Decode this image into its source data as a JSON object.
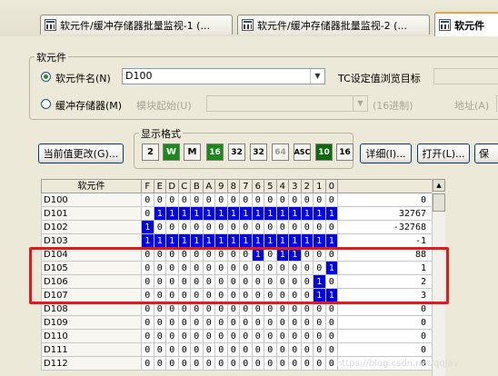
{
  "tabs": [
    {
      "label": "软元件/缓冲存储器批量监视-1 (..."
    },
    {
      "label": "软元件/缓冲存储器批量监视-2 (..."
    },
    {
      "label": "软元件"
    }
  ],
  "device_group": {
    "legend": "软元件",
    "device_name_label": "软元件名(N)",
    "device_name_value": "D100",
    "tc_label": "TC设定值浏览目标",
    "buffer_label": "缓冲存储器(M)",
    "module_start_label": "模块起始(U)",
    "hex_label": "(16进制)",
    "address_label": "地址(A)"
  },
  "format_group": {
    "legend": "显示格式",
    "buttons": [
      {
        "label": "2"
      },
      {
        "label": "W"
      },
      {
        "label": "M"
      },
      {
        "label": "16"
      },
      {
        "label": "32"
      },
      {
        "label": "32"
      },
      {
        "label": "64"
      },
      {
        "label": "ASC"
      },
      {
        "label": "10"
      },
      {
        "label": "16"
      }
    ]
  },
  "actions": {
    "change_value": "当前值更改(G)...",
    "details": "详细(I)...",
    "open": "打开(L)...",
    "save": "保"
  },
  "grid": {
    "header_device": "软元件",
    "bit_headers": [
      "F",
      "E",
      "D",
      "C",
      "B",
      "A",
      "9",
      "8",
      "7",
      "6",
      "5",
      "4",
      "3",
      "2",
      "1",
      "0"
    ],
    "rows": [
      {
        "name": "D100",
        "bits": [
          0,
          0,
          0,
          0,
          0,
          0,
          0,
          0,
          0,
          0,
          0,
          0,
          0,
          0,
          0,
          0
        ],
        "value": "0"
      },
      {
        "name": "D101",
        "bits": [
          0,
          1,
          1,
          1,
          1,
          1,
          1,
          1,
          1,
          1,
          1,
          1,
          1,
          1,
          1,
          1
        ],
        "value": "32767"
      },
      {
        "name": "D102",
        "bits": [
          1,
          0,
          0,
          0,
          0,
          0,
          0,
          0,
          0,
          0,
          0,
          0,
          0,
          0,
          0,
          0
        ],
        "value": "-32768"
      },
      {
        "name": "D103",
        "bits": [
          1,
          1,
          1,
          1,
          1,
          1,
          1,
          1,
          1,
          1,
          1,
          1,
          1,
          1,
          1,
          1
        ],
        "value": "-1"
      },
      {
        "name": "D104",
        "bits": [
          0,
          0,
          0,
          0,
          0,
          0,
          0,
          0,
          0,
          1,
          0,
          1,
          1,
          0,
          0,
          0
        ],
        "value": "88"
      },
      {
        "name": "D105",
        "bits": [
          0,
          0,
          0,
          0,
          0,
          0,
          0,
          0,
          0,
          0,
          0,
          0,
          0,
          0,
          0,
          1
        ],
        "value": "1"
      },
      {
        "name": "D106",
        "bits": [
          0,
          0,
          0,
          0,
          0,
          0,
          0,
          0,
          0,
          0,
          0,
          0,
          0,
          0,
          1,
          0
        ],
        "value": "2"
      },
      {
        "name": "D107",
        "bits": [
          0,
          0,
          0,
          0,
          0,
          0,
          0,
          0,
          0,
          0,
          0,
          0,
          0,
          0,
          1,
          1
        ],
        "value": "3"
      },
      {
        "name": "D108",
        "bits": [
          0,
          0,
          0,
          0,
          0,
          0,
          0,
          0,
          0,
          0,
          0,
          0,
          0,
          0,
          0,
          0
        ],
        "value": "0"
      },
      {
        "name": "D109",
        "bits": [
          0,
          0,
          0,
          0,
          0,
          0,
          0,
          0,
          0,
          0,
          0,
          0,
          0,
          0,
          0,
          0
        ],
        "value": "0"
      },
      {
        "name": "D110",
        "bits": [
          0,
          0,
          0,
          0,
          0,
          0,
          0,
          0,
          0,
          0,
          0,
          0,
          0,
          0,
          0,
          0
        ],
        "value": "0"
      },
      {
        "name": "D111",
        "bits": [
          0,
          0,
          0,
          0,
          0,
          0,
          0,
          0,
          0,
          0,
          0,
          0,
          0,
          0,
          0,
          0
        ],
        "value": "0"
      },
      {
        "name": "D112",
        "bits": [
          0,
          0,
          0,
          0,
          0,
          0,
          0,
          0,
          0,
          0,
          0,
          0,
          0,
          0,
          0,
          0
        ],
        "value": "0"
      }
    ]
  },
  "watermark": "https://blog.csdn.net/qqjav",
  "colors": {
    "bit_set": "#0000e6",
    "highlight": "#e01b1b",
    "active_tab_accent": "#f1a33a"
  }
}
